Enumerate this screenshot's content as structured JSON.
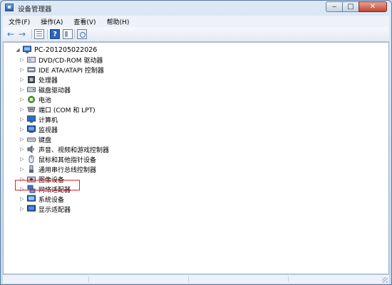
{
  "window": {
    "title": "设备管理器",
    "controls": {
      "minimize": "‒",
      "maximize": "□",
      "close": "✕"
    }
  },
  "menu": [
    {
      "label": "文件(F)"
    },
    {
      "label": "操作(A)"
    },
    {
      "label": "查看(V)"
    },
    {
      "label": "帮助(H)"
    }
  ],
  "toolbar": {
    "back_icon": "←",
    "forward_icon": "→",
    "help_icon": "?"
  },
  "tree": {
    "root_expander": "◢",
    "root": "PC-201205022026",
    "expander": "▷",
    "items": [
      {
        "label": "DVD/CD-ROM 驱动器",
        "icon": "dvd-drive-icon"
      },
      {
        "label": "IDE ATA/ATAPI 控制器",
        "icon": "ide-controller-icon"
      },
      {
        "label": "处理器",
        "icon": "processor-icon"
      },
      {
        "label": "磁盘驱动器",
        "icon": "disk-drive-icon"
      },
      {
        "label": "电池",
        "icon": "battery-icon"
      },
      {
        "label": "端口 (COM 和 LPT)",
        "icon": "port-icon"
      },
      {
        "label": "计算机",
        "icon": "computer-icon"
      },
      {
        "label": "监视器",
        "icon": "monitor-icon"
      },
      {
        "label": "键盘",
        "icon": "keyboard-icon"
      },
      {
        "label": "声音、视频和游戏控制器",
        "icon": "sound-icon"
      },
      {
        "label": "鼠标和其他指针设备",
        "icon": "mouse-icon"
      },
      {
        "label": "通用串行总线控制器",
        "icon": "usb-icon"
      },
      {
        "label": "图像设备",
        "icon": "imaging-device-icon"
      },
      {
        "label": "网络适配器",
        "icon": "network-adapter-icon"
      },
      {
        "label": "系统设备",
        "icon": "system-device-icon"
      },
      {
        "label": "显示适配器",
        "icon": "display-adapter-icon"
      }
    ]
  },
  "colors": {
    "highlight_border": "#e0242a",
    "title_bar": "#dce8f5",
    "close_button": "#c24630"
  }
}
